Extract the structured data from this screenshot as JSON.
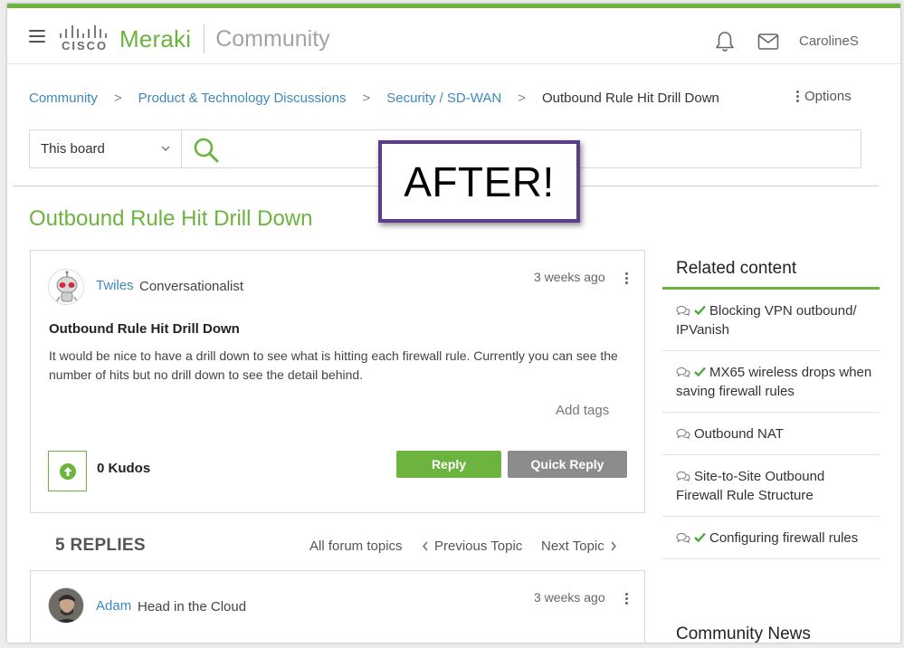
{
  "header": {
    "brand_cisco": "CISCO",
    "brand_meraki": "Meraki",
    "brand_community": "Community",
    "username": "CarolineS",
    "colors": {
      "accent": "#6cb33f",
      "link": "#3d88bc",
      "callout_border": "#5b3d8c"
    }
  },
  "breadcrumb": {
    "items": [
      "Community",
      "Product & Technology Discussions",
      "Security / SD-WAN"
    ],
    "current": "Outbound Rule Hit Drill Down",
    "separator": ">"
  },
  "options_label": "Options",
  "search": {
    "scope": "This board",
    "value": ""
  },
  "callout": "AFTER!",
  "page_title": "Outbound Rule Hit Drill Down",
  "post": {
    "author": "Twiles",
    "rank": "Conversationalist",
    "time": "3 weeks ago",
    "subject": "Outbound Rule Hit Drill Down",
    "body": "It would be nice to have a drill down to see what is hitting each firewall rule. Currently you can see the number of hits but no drill down to see the detail behind.",
    "add_tags": "Add tags",
    "kudos": "0 Kudos",
    "reply_label": "Reply",
    "quick_reply_label": "Quick Reply"
  },
  "replies": {
    "count_label": "5 REPLIES",
    "all_topics": "All forum topics",
    "previous": "Previous Topic",
    "next": "Next Topic"
  },
  "reply": {
    "author": "Adam",
    "rank": "Head in the Cloud",
    "time": "3 weeks ago"
  },
  "sidebar": {
    "title": "Related content",
    "items": [
      {
        "label": "Blocking VPN outbound/ IPVanish",
        "solved": true
      },
      {
        "label": "MX65 wireless drops when saving firewall rules",
        "solved": true
      },
      {
        "label": "Outbound NAT",
        "solved": false
      },
      {
        "label": "Site-to-Site Outbound Firewall Rule Structure",
        "solved": false
      },
      {
        "label": "Configuring firewall rules",
        "solved": true
      }
    ],
    "news_title": "Community News"
  }
}
